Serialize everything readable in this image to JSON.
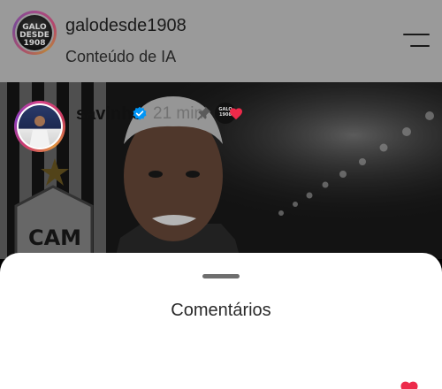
{
  "header": {
    "username": "galodesde1908",
    "subtitle": "Conteúdo de IA",
    "avatar_logo_text": "GALO DESDE 1908"
  },
  "photo": {
    "crest_text": "CAM"
  },
  "comments_sheet": {
    "title": "Comentários",
    "comment": {
      "username": "savinho",
      "time": "21 min",
      "creator_badge_text": "GALO 1908"
    }
  },
  "colors": {
    "sheet_background": "#ffffff",
    "verified_blue": "#0095f6",
    "heart_red": "#ed2a4a",
    "overlay_dim": "rgba(0,0,0,0.4)"
  },
  "icons": [
    "menu-icon",
    "verified-icon",
    "pin-icon",
    "heart-icon"
  ]
}
